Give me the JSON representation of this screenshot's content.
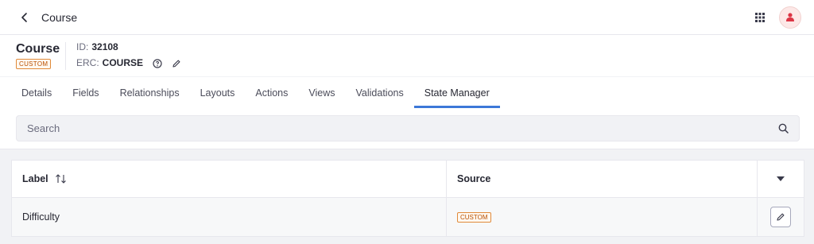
{
  "topbar": {
    "title": "Course",
    "back_icon": "chevron-left-icon",
    "apps_icon": "apps-grid-icon",
    "avatar_icon": "user-icon"
  },
  "object": {
    "title": "Course",
    "badge": "CUSTOM",
    "id_label": "ID:",
    "id_value": "32108",
    "erc_label": "ERC:",
    "erc_value": "COURSE"
  },
  "tabs": [
    {
      "label": "Details",
      "active": false
    },
    {
      "label": "Fields",
      "active": false
    },
    {
      "label": "Relationships",
      "active": false
    },
    {
      "label": "Layouts",
      "active": false
    },
    {
      "label": "Actions",
      "active": false
    },
    {
      "label": "Views",
      "active": false
    },
    {
      "label": "Validations",
      "active": false
    },
    {
      "label": "State Manager",
      "active": true
    }
  ],
  "search": {
    "placeholder": "Search",
    "value": ""
  },
  "table": {
    "columns": {
      "label": "Label",
      "source": "Source"
    },
    "rows": [
      {
        "label": "Difficulty",
        "source": "CUSTOM"
      }
    ]
  },
  "colors": {
    "accent": "#3d78d8",
    "badge_text": "#b95000",
    "avatar": "#dc3545"
  }
}
